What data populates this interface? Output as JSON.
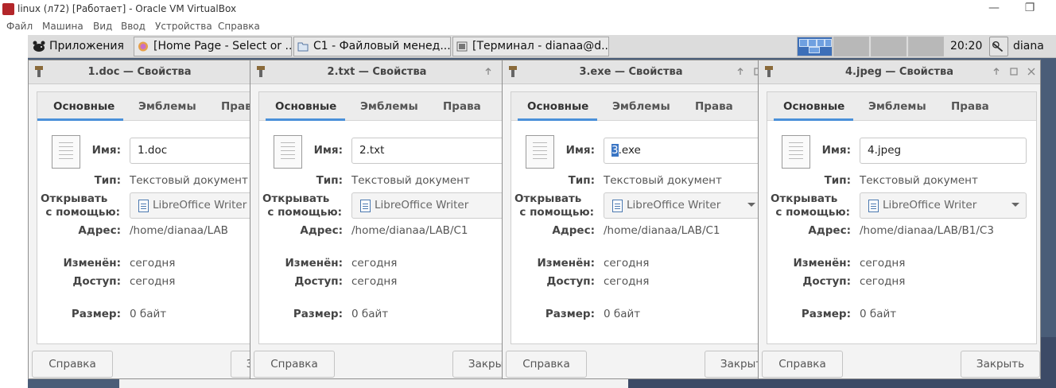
{
  "host": {
    "title": "linux (л72) [Работает] - Oracle VM VirtualBox",
    "menu": [
      "Файл",
      "Машина",
      "Вид",
      "Ввод",
      "Устройства",
      "Справка"
    ],
    "min_glyph": "—",
    "restore_glyph": "❐"
  },
  "panel": {
    "apps_label": "Приложения",
    "tasks": [
      "[Home Page - Select or ...",
      "C1 - Файловый менед...",
      "[Терминал - dianaa@d..."
    ],
    "clock": "20:20",
    "user": "diana"
  },
  "labels": {
    "tab_basic": "Основные",
    "tab_emblems": "Эмблемы",
    "tab_rights": "Права",
    "name": "Имя:",
    "type": "Тип:",
    "open_with_1": "Открывать",
    "open_with_2": "с помощью:",
    "address": "Адрес:",
    "modified": "Изменён:",
    "access": "Доступ:",
    "size": "Размер:",
    "help": "Справка",
    "close": "Закрыть"
  },
  "common": {
    "type_value": "Текстовый документ",
    "app": "LibreOffice Writer",
    "modified": "сегодня",
    "access": "сегодня",
    "size": "0 байт"
  },
  "dialogs": [
    {
      "title": "1.doc — Свойства",
      "name": "1.doc",
      "address": "/home/dianaa/LAB"
    },
    {
      "title": "2.txt — Свойства",
      "name": "2.txt",
      "address": "/home/dianaa/LAB/C1"
    },
    {
      "title": "3.exe — Свойства",
      "name_sel": "3",
      "name_rest": ".exe",
      "address": "/home/dianaa/LAB/C1"
    },
    {
      "title": "4.jpeg — Свойства",
      "name": "4.jpeg",
      "address": "/home/dianaa/LAB/B1/C3"
    }
  ]
}
